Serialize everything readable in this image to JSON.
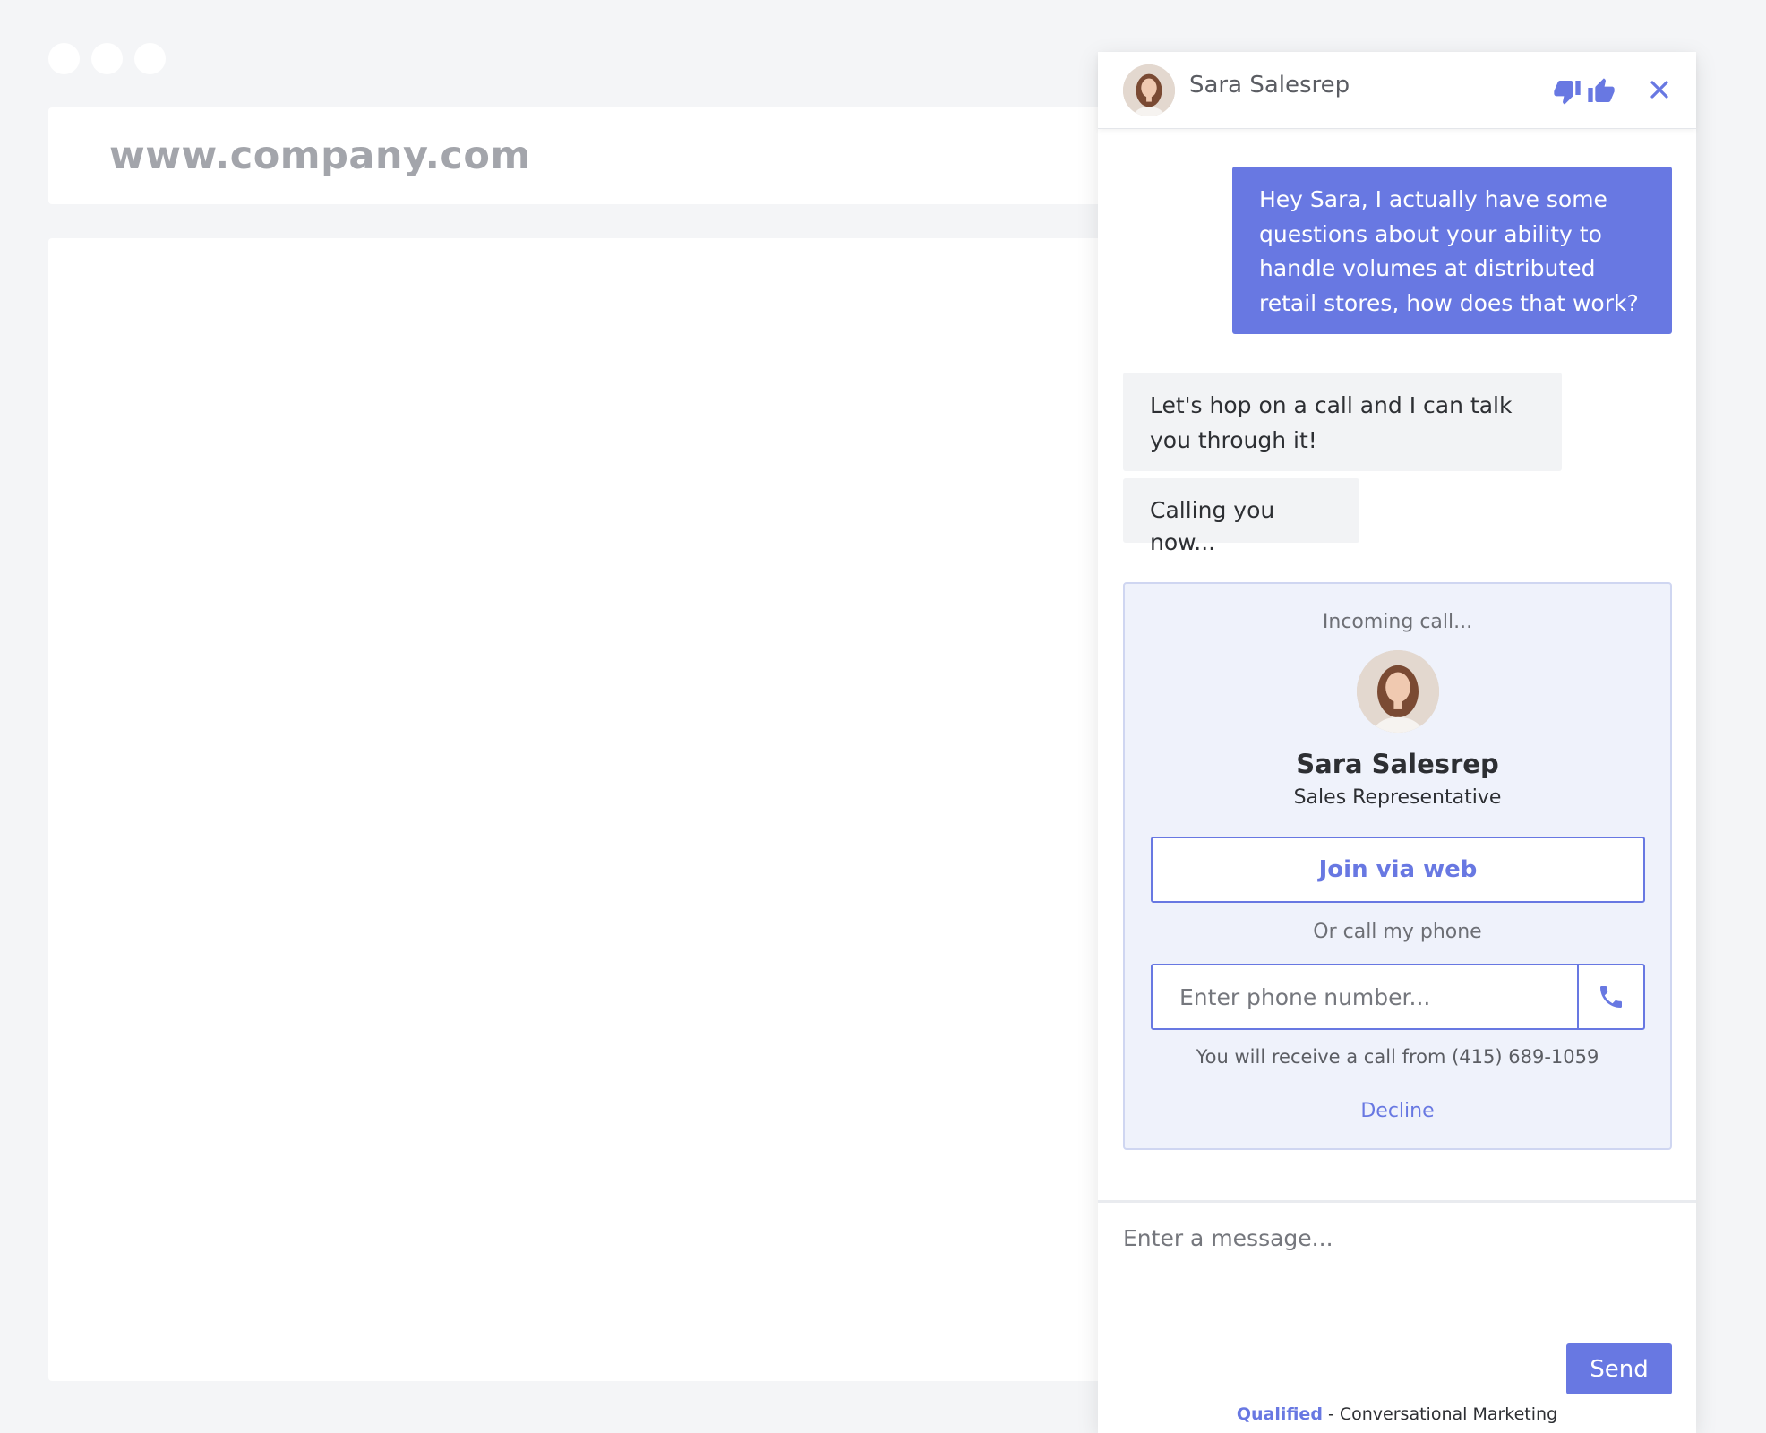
{
  "browser": {
    "address": "www.company.com"
  },
  "chat": {
    "agent_name": "Sara Salesrep",
    "messages": [
      {
        "from": "visitor",
        "text": "Hey Sara, I actually have some questions about your ability to handle volumes at distributed retail stores, how does that work?"
      },
      {
        "from": "agent",
        "text": "Let's hop on a call and I can talk you through it!"
      },
      {
        "from": "agent",
        "text": "Calling you now..."
      }
    ],
    "call": {
      "status": "Incoming call...",
      "name": "Sara Salesrep",
      "role": "Sales Representative",
      "join_label": "Join via web",
      "or_label": "Or call my phone",
      "phone_placeholder": "Enter phone number...",
      "receive_text": "You will receive a call from (415) 689-1059",
      "decline_label": "Decline"
    },
    "compose_placeholder": "Enter a message...",
    "send_label": "Send",
    "footer": {
      "brand": "Qualified",
      "tagline": " - Conversational Marketing"
    }
  },
  "icons": {
    "thumb_down": "thumb-down-icon",
    "thumb_up": "thumb-up-icon",
    "close": "close-icon",
    "phone": "phone-icon"
  },
  "colors": {
    "accent": "#6878e2",
    "background": "#f4f5f7",
    "agent_bubble": "#f2f3f5",
    "call_card": "#eff2fb"
  }
}
